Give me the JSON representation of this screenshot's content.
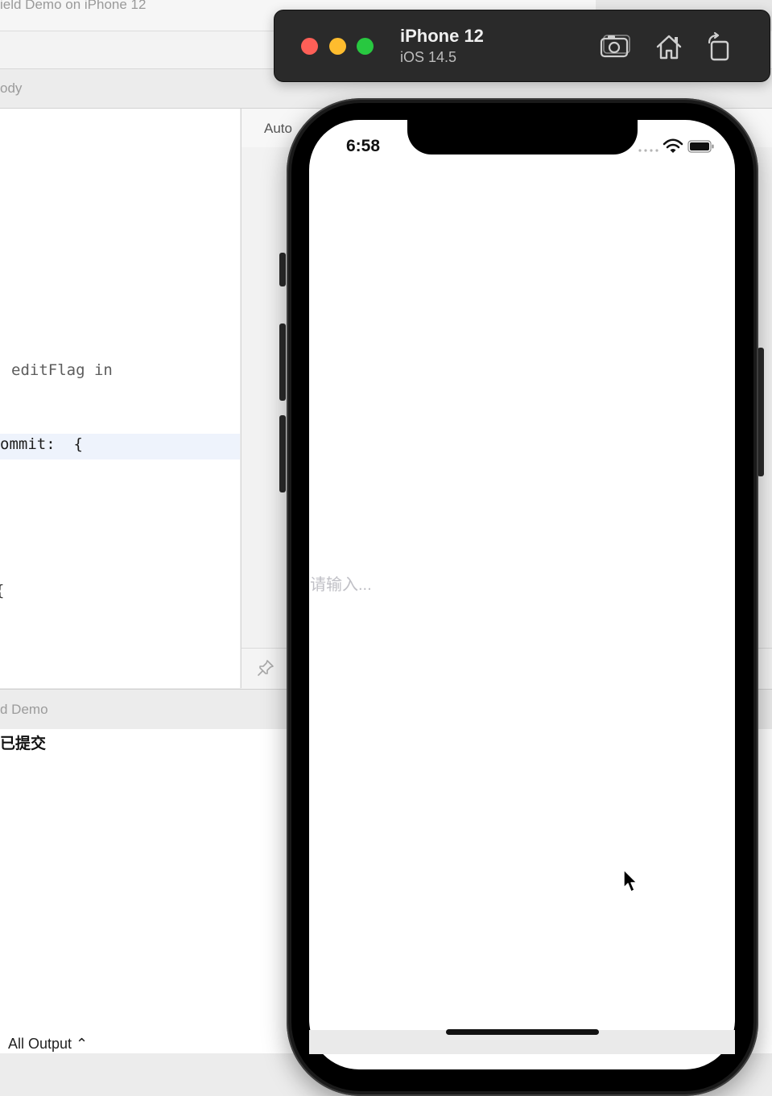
{
  "xcode": {
    "window_title": "ield Demo on iPhone 12",
    "jump_bar_label": "ody",
    "code": {
      "line_edit_flag": "editFlag in",
      "line_commit": "ommit:  {",
      "line_brace": "{"
    },
    "canvas_label": "Auto",
    "debug_area_title": "d Demo",
    "console_output_line": "已提交",
    "output_selector": "All Output ⌃"
  },
  "simulator": {
    "device_name": "iPhone 12",
    "os_version": "iOS 14.5",
    "toolbar_icons": [
      "screenshot-icon",
      "home-icon",
      "rotate-icon"
    ]
  },
  "phone": {
    "status_time": "6:58",
    "text_field_placeholder": "请输入..."
  },
  "colors": {
    "close": "#fe5f57",
    "minimize": "#febc2e",
    "maximize": "#28c840",
    "line_highlight": "#eef3fc"
  }
}
